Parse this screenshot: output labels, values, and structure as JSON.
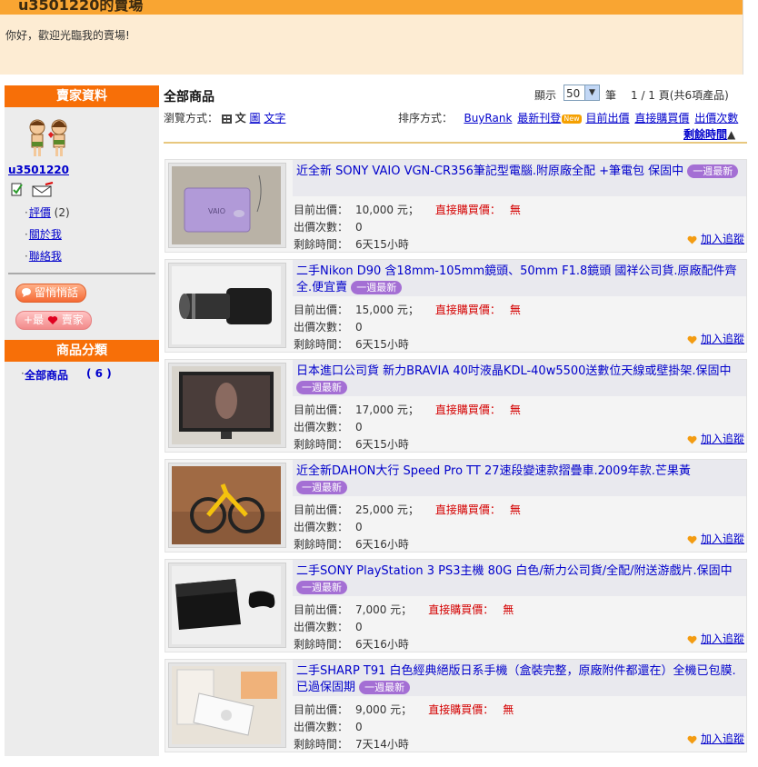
{
  "header": {
    "store_title": "u3501220的賣場",
    "greeting": "你好，歡迎光臨我的賣場!"
  },
  "sidebar": {
    "seller_header": "賣家資料",
    "username": "u3501220",
    "links": [
      {
        "label": "評價",
        "count": "(2)"
      },
      {
        "label": "關於我"
      },
      {
        "label": "聯絡我"
      }
    ],
    "message_button": "留悄悄話",
    "favorite_button": "最",
    "favorite_button_suffix": "賣家",
    "favorite_prefix": "+",
    "category_header": "商品分類",
    "category": {
      "label": "全部商品",
      "count": "( 6 )"
    }
  },
  "main": {
    "title": "全部商品",
    "display_label": "顯示",
    "display_value": "50",
    "unit_label": "筆",
    "page_info": "1 / 1 頁(共6項產品)",
    "view_label": "瀏覽方式：",
    "view_options": {
      "current": "文",
      "picture": "圖",
      "text": "文字"
    },
    "sort_label": "排序方式：",
    "sort_options": [
      "BuyRank",
      "最新刊登",
      "目前出價",
      "直接購買價",
      "出價次數"
    ],
    "sort_new_badge": "New",
    "sort_time": "剩餘時間",
    "sort_arrow": "▲"
  },
  "labels": {
    "price": "目前出價：",
    "bids": "出價次數：",
    "time": "剩餘時間：",
    "buy_now": "直接購買價：",
    "buy_none": "無",
    "week_new": "一週最新",
    "watch": "加入追蹤"
  },
  "items": [
    {
      "title": "近全新 SONY VAIO VGN-CR356筆記型電腦.附原廠全配 +筆電包 保固中",
      "price": "10,000 元；",
      "bids": "0",
      "time": "6天15小時"
    },
    {
      "title": "二手Nikon D90 含18mm-105mm鏡頭、50mm F1.8鏡頭 國祥公司貨.原廠配件齊全.便宜賣",
      "price": "15,000 元；",
      "bids": "0",
      "time": "6天15小時"
    },
    {
      "title": "日本進口公司貨 新力BRAVIA 40吋液晶KDL-40w5500送數位天線或壁掛架.保固中",
      "price": "17,000 元；",
      "bids": "0",
      "time": "6天15小時"
    },
    {
      "title": "近全新DAHON大行 Speed Pro TT 27速段變速款摺疊車.2009年款.芒果黃",
      "price": "25,000 元；",
      "bids": "0",
      "time": "6天16小時"
    },
    {
      "title": "二手SONY PlayStation 3 PS3主機 80G 白色/新力公司貨/全配/附送游戲片.保固中",
      "price": "7,000 元；",
      "bids": "0",
      "time": "6天16小時"
    },
    {
      "title": "二手SHARP T91 白色經典絕版日系手機（盒裝完整，原廠附件都還在）全機已包膜.已過保固期",
      "price": "9,000 元；",
      "bids": "0",
      "time": "7天14小時"
    }
  ]
}
